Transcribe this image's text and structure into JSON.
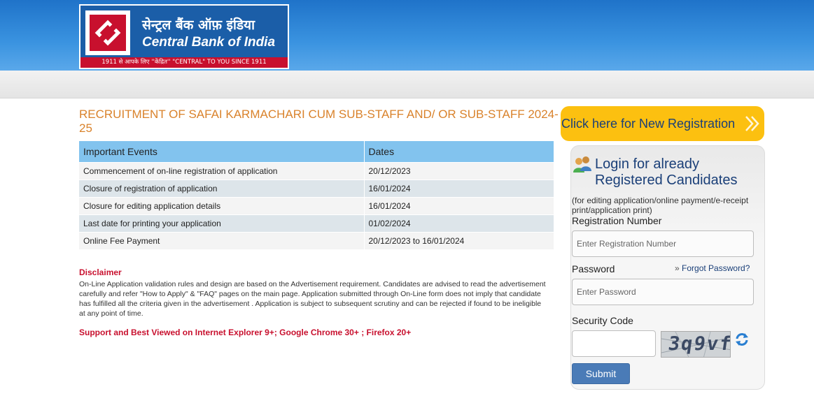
{
  "header": {
    "logo_hindi": "सेन्ट्रल बैंक ऑफ़ इंडिया",
    "logo_english": "Central Bank of India",
    "logo_tagline": "1911 से आपके लिए ''केंद्रित'' \"CENTRAL\" TO YOU SINCE 1911"
  },
  "main": {
    "title": "RECRUITMENT OF SAFAI KARMACHARI CUM SUB-STAFF AND/ OR SUB-STAFF 2024-25",
    "table": {
      "headers": [
        "Important Events",
        "Dates"
      ],
      "rows": [
        [
          "Commencement of on-line registration of application",
          "20/12/2023"
        ],
        [
          "Closure of registration of application",
          "16/01/2024"
        ],
        [
          "Closure for editing application details",
          "16/01/2024"
        ],
        [
          "Last date for printing your application",
          "01/02/2024"
        ],
        [
          "Online Fee Payment",
          "20/12/2023 to 16/01/2024"
        ]
      ]
    },
    "disclaimer_title": "Disclaimer",
    "disclaimer_text": "On-Line Application validation rules and design are based on the Advertisement requirement. Candidates are advised to read the advertisement carefully and refer \"How to Apply\" & \"FAQ\" pages on the main page. Application submitted through On-Line form does not imply that candidate has fulfilled all the criteria given in the advertisement . Application is subject to subsequent scrutiny and can be rejected if found to be ineligible at any point of time.",
    "support_text": "Support and Best Viewed on Internet Explorer 9+; Google Chrome 30+ ; Firefox 20+"
  },
  "sidebar": {
    "new_registration_label": "Click here for New Registration",
    "login_title": "Login for already Registered Candidates",
    "login_subtitle": "(for editing application/online payment/e-receipt print/application print)",
    "registration_label": "Registration Number",
    "registration_placeholder": "Enter Registration Number",
    "password_label": "Password",
    "forgot_label": "Forgot Password?",
    "password_placeholder": "Enter Password",
    "security_label": "Security Code",
    "captcha_text": "3q9vf",
    "submit_label": "Submit"
  },
  "colors": {
    "header_blue": "#2a83d6",
    "title_orange": "#d9822b",
    "table_header": "#82c3ee",
    "disclaimer_red": "#c8102e",
    "registration_button": "#fcc010",
    "submit_button": "#4a7bb7"
  },
  "icons": [
    "bank-logo-icon",
    "chevron-double-right-icon",
    "users-icon",
    "double-chevron-icon",
    "refresh-icon"
  ]
}
